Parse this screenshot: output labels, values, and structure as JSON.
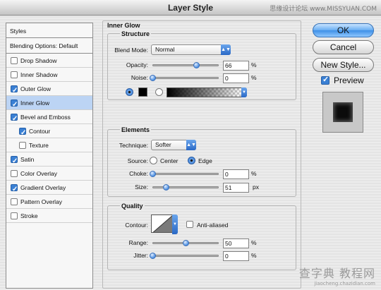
{
  "window": {
    "title": "Layer Style"
  },
  "watermarks": {
    "top": "思缘设计论坛 www.MISSYUAN.COM",
    "bottom_big": "查字典 教程网",
    "bottom_small": "jiaocheng.chazidian.com"
  },
  "styles_list": {
    "header": "Styles",
    "blending_options": "Blending Options: Default",
    "items": [
      {
        "label": "Drop Shadow",
        "checked": false,
        "indent": false,
        "selected": false
      },
      {
        "label": "Inner Shadow",
        "checked": false,
        "indent": false,
        "selected": false
      },
      {
        "label": "Outer Glow",
        "checked": true,
        "indent": false,
        "selected": false
      },
      {
        "label": "Inner Glow",
        "checked": true,
        "indent": false,
        "selected": true
      },
      {
        "label": "Bevel and Emboss",
        "checked": true,
        "indent": false,
        "selected": false
      },
      {
        "label": "Contour",
        "checked": true,
        "indent": true,
        "selected": false
      },
      {
        "label": "Texture",
        "checked": false,
        "indent": true,
        "selected": false
      },
      {
        "label": "Satin",
        "checked": true,
        "indent": false,
        "selected": false
      },
      {
        "label": "Color Overlay",
        "checked": false,
        "indent": false,
        "selected": false
      },
      {
        "label": "Gradient Overlay",
        "checked": true,
        "indent": false,
        "selected": false
      },
      {
        "label": "Pattern Overlay",
        "checked": false,
        "indent": false,
        "selected": false
      },
      {
        "label": "Stroke",
        "checked": false,
        "indent": false,
        "selected": false
      }
    ]
  },
  "inner_glow": {
    "title": "Inner Glow",
    "structure": {
      "title": "Structure",
      "blend_mode_label": "Blend Mode:",
      "blend_mode_value": "Normal",
      "opacity_label": "Opacity:",
      "opacity_value": "66",
      "opacity_unit": "%",
      "opacity_level": 0.66,
      "noise_label": "Noise:",
      "noise_value": "0",
      "noise_unit": "%",
      "noise_level": 0
    },
    "elements": {
      "title": "Elements",
      "technique_label": "Technique:",
      "technique_value": "Softer",
      "source_label": "Source:",
      "source_center": "Center",
      "source_edge": "Edge",
      "choke_label": "Choke:",
      "choke_value": "0",
      "choke_unit": "%",
      "choke_level": 0,
      "size_label": "Size:",
      "size_value": "51",
      "size_unit": "px",
      "size_level": 0.2
    },
    "quality": {
      "title": "Quality",
      "contour_label": "Contour:",
      "anti_aliased_label": "Anti-aliased",
      "range_label": "Range:",
      "range_value": "50",
      "range_unit": "%",
      "range_level": 0.5,
      "jitter_label": "Jitter:",
      "jitter_value": "0",
      "jitter_unit": "%",
      "jitter_level": 0
    }
  },
  "buttons": {
    "ok": "OK",
    "cancel": "Cancel",
    "new_style": "New Style...",
    "preview": "Preview"
  },
  "colors": {
    "accent": "#3e8fe6",
    "glow_color": "#000000",
    "selected_row": "#bcd4f4"
  }
}
